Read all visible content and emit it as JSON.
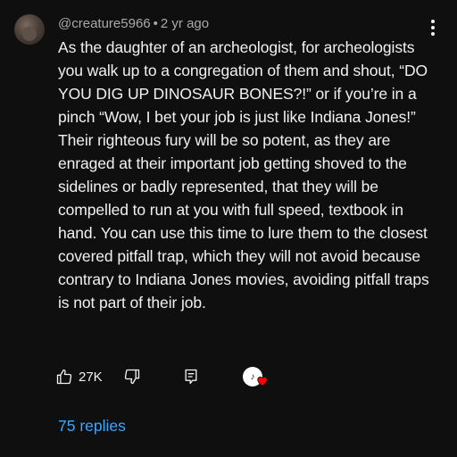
{
  "comment": {
    "author": "@creature5966",
    "separator": "•",
    "time": "2 yr ago",
    "text": "As the daughter of an archeologist, for archeologists you walk up to a congregation of them and shout, “DO YOU DIG UP DINOSAUR BONES?!” or if you’re in a pinch “Wow, I bet your job is just like Indiana Jones!” Their righteous fury will be so potent, as they are enraged at their important job getting shoved to the sidelines or badly represented, that they will be compelled to run at you with full speed, textbook in hand. You can use this time to lure them to the closest covered pitfall trap, which they will not avoid because contrary to Indiana Jones movies, avoiding pitfall traps is not part of their job."
  },
  "actions": {
    "like_count": "27K",
    "like_icon": "thumbs-up-icon",
    "dislike_icon": "thumbs-down-icon",
    "reply_icon": "reply-icon",
    "heart_icon": "creator-heart-icon",
    "heart_color": "#ff0000"
  },
  "replies": {
    "label": "75 replies",
    "color": "#3ea6ff"
  },
  "menu_icon": "more-vert-icon"
}
